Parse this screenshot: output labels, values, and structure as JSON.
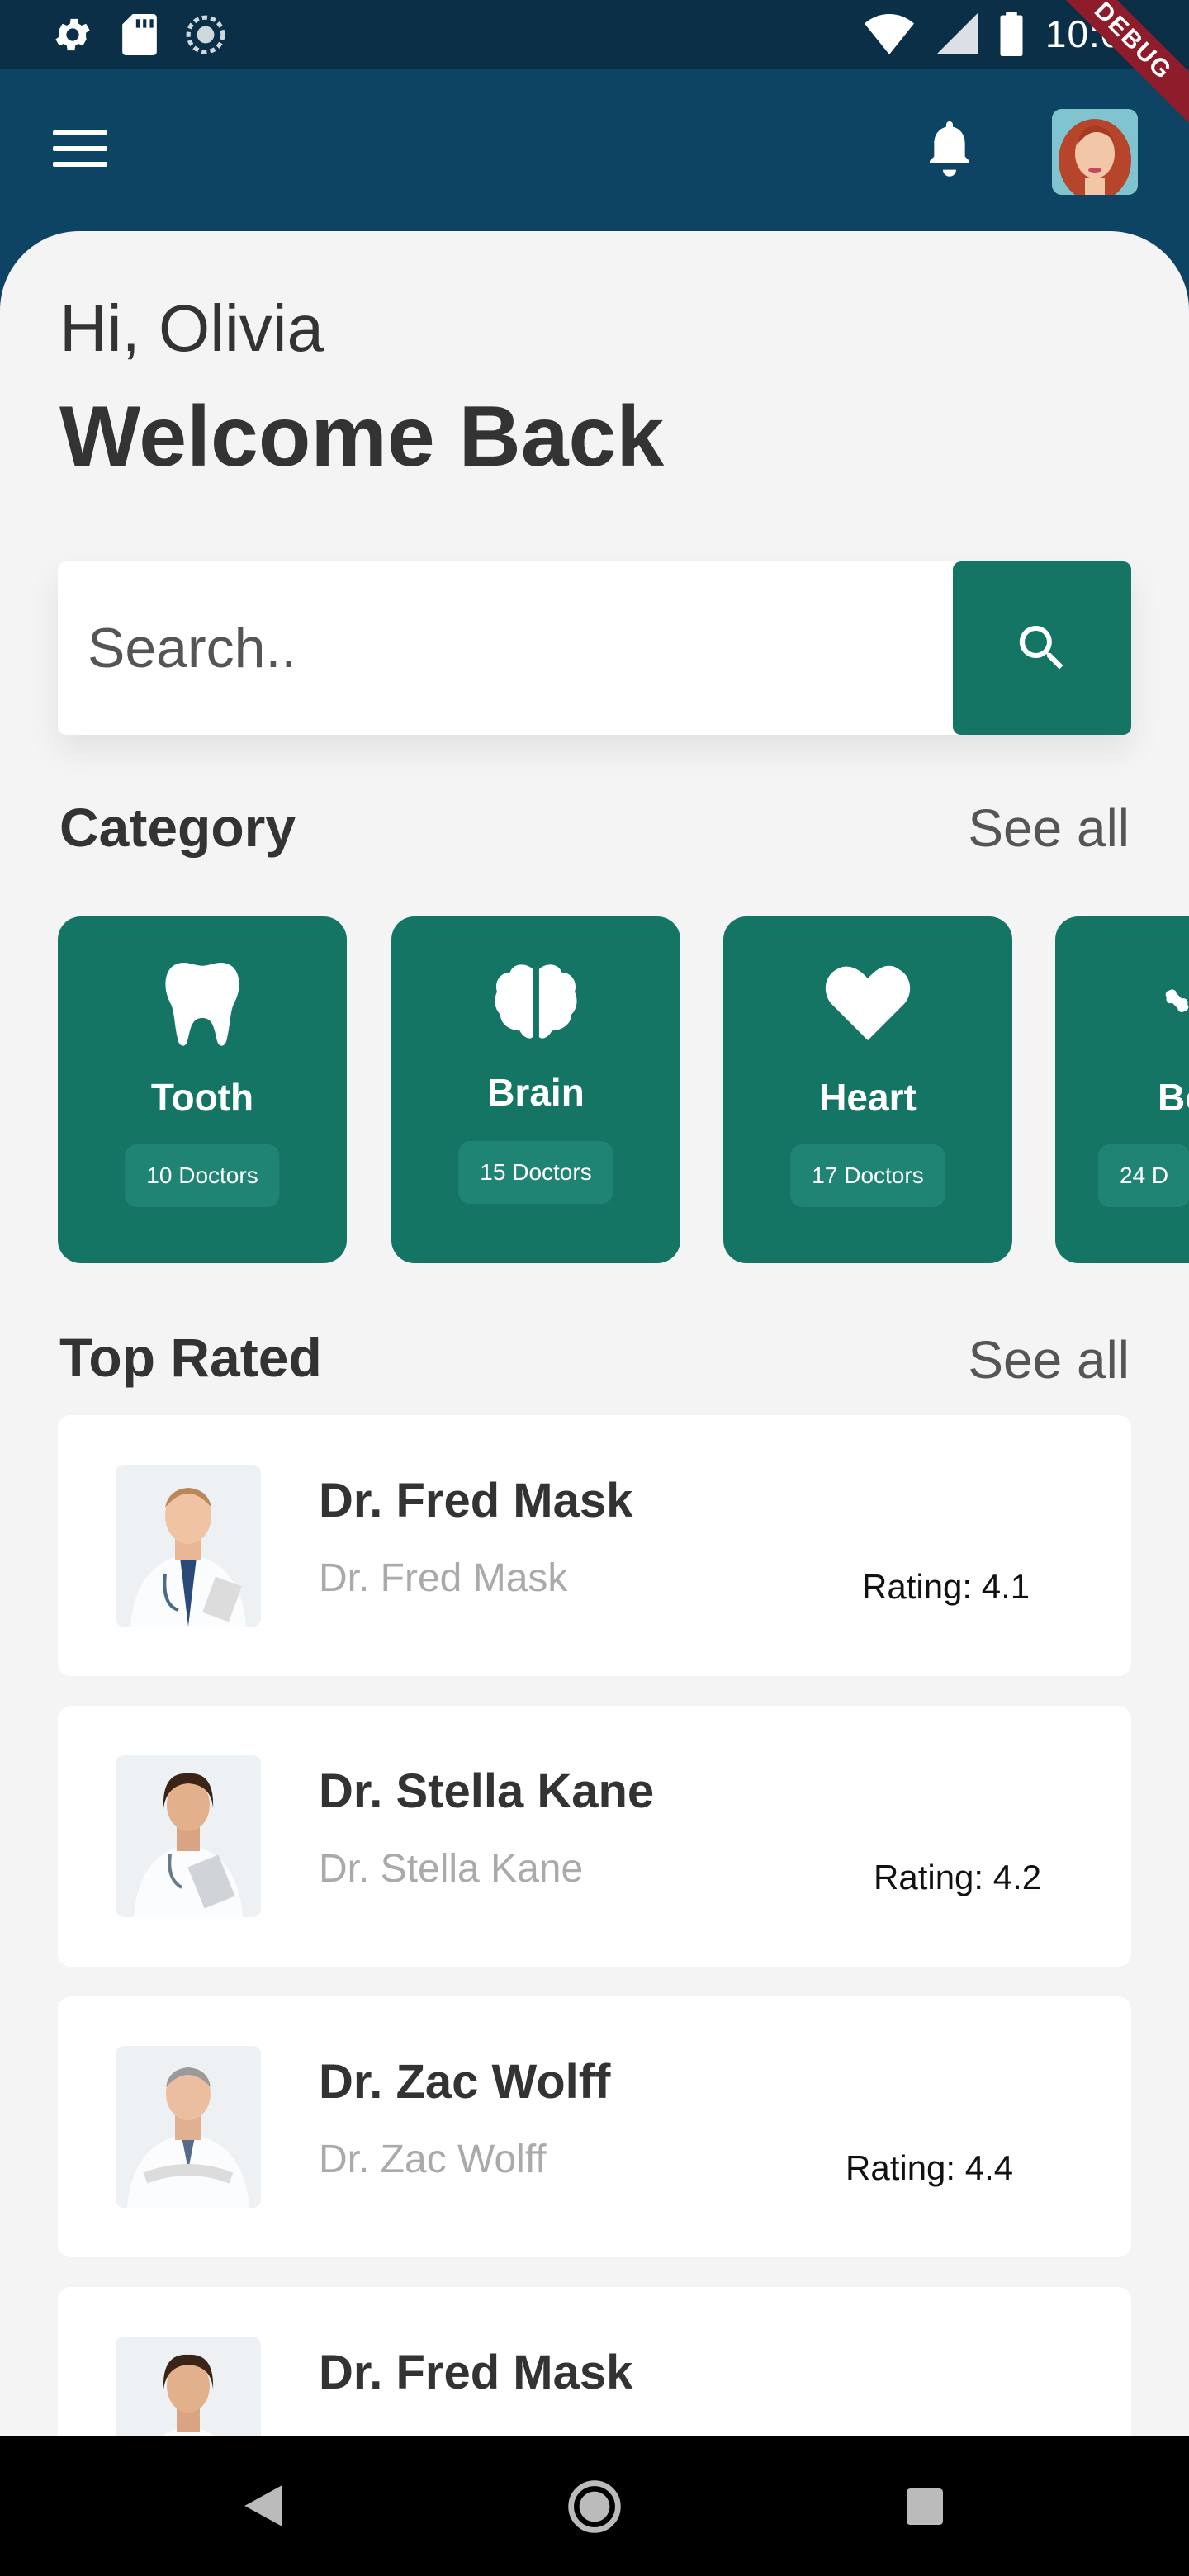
{
  "status_bar": {
    "time": "10:06",
    "left_icons": [
      "settings-icon",
      "sd-card-icon",
      "sync-icon"
    ],
    "right_icons": [
      "wifi-icon",
      "signal-icon",
      "battery-icon"
    ],
    "debug_label": "DEBUG"
  },
  "app_bar": {
    "icons": [
      "menu-icon",
      "notification-bell-icon",
      "user-avatar"
    ]
  },
  "greeting": "Hi, Olivia",
  "welcome": "Welcome Back",
  "search": {
    "placeholder": "Search..",
    "icon": "search-icon"
  },
  "category": {
    "title": "Category",
    "see_all": "See all",
    "items": [
      {
        "name": "Tooth",
        "count": "10 Doctors",
        "icon": "tooth-icon"
      },
      {
        "name": "Brain",
        "count": "15 Doctors",
        "icon": "brain-icon"
      },
      {
        "name": "Heart",
        "count": "17 Doctors",
        "icon": "heart-icon"
      },
      {
        "name": "Bo",
        "count": "24 D",
        "icon": "bone-icon"
      }
    ]
  },
  "top_rated": {
    "title": "Top Rated",
    "see_all": "See all",
    "doctors": [
      {
        "name": "Dr. Fred Mask",
        "subtitle": "Dr. Fred Mask",
        "rating_label": "Rating:",
        "rating": "4.1"
      },
      {
        "name": "Dr. Stella Kane",
        "subtitle": "Dr. Stella Kane",
        "rating_label": "Rating:",
        "rating": "4.2"
      },
      {
        "name": "Dr. Zac Wolff",
        "subtitle": "Dr. Zac Wolff",
        "rating_label": "Rating:",
        "rating": "4.4"
      },
      {
        "name": "Dr. Fred Mask",
        "subtitle": "",
        "rating_label": "",
        "rating": ""
      }
    ]
  },
  "nav_bar": {
    "icons": [
      "back-icon",
      "home-icon",
      "recents-icon"
    ]
  },
  "colors": {
    "header": "#0d4463",
    "accent": "#147565",
    "background": "#f4f4f4"
  }
}
